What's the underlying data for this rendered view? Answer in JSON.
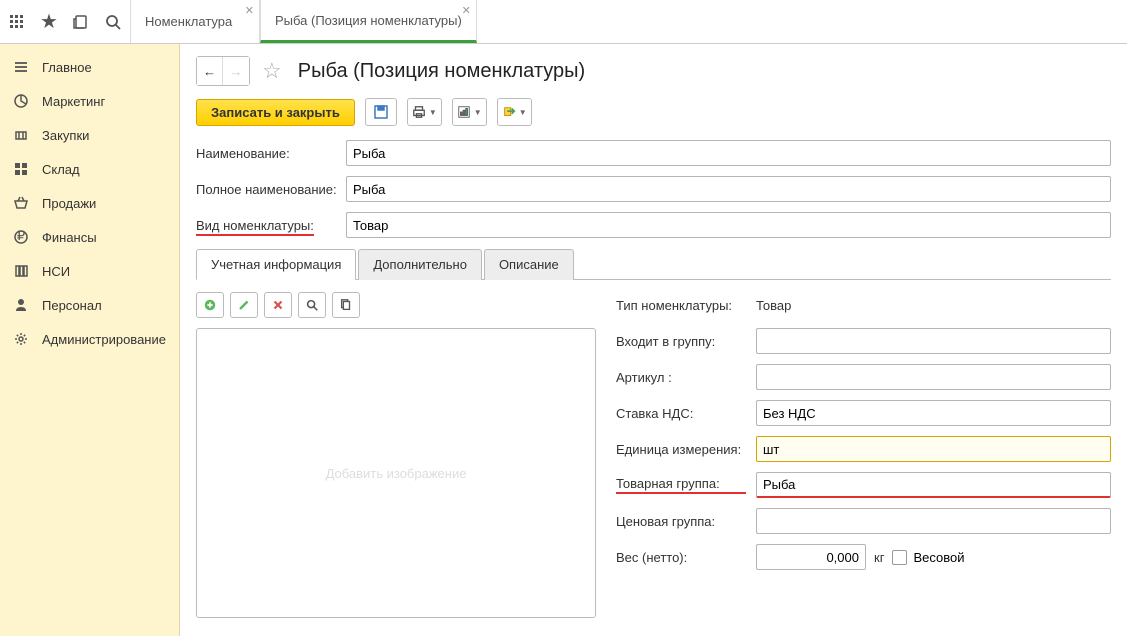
{
  "tabs": {
    "tab1": "Номенклатура",
    "tab2": "Рыба (Позиция номенклатуры)"
  },
  "sidebar": {
    "items": [
      "Главное",
      "Маркетинг",
      "Закупки",
      "Склад",
      "Продажи",
      "Финансы",
      "НСИ",
      "Персонал",
      "Администрирование"
    ]
  },
  "page": {
    "title": "Рыба (Позиция номенклатуры)"
  },
  "toolbar": {
    "save_close": "Записать и закрыть"
  },
  "form": {
    "name_label": "Наименование:",
    "name_value": "Рыба",
    "fullname_label": "Полное наименование:",
    "fullname_value": "Рыба",
    "type_label": "Вид номенклатуры:",
    "type_value": "Товар"
  },
  "subtabs": {
    "tab1": "Учетная информация",
    "tab2": "Дополнительно",
    "tab3": "Описание"
  },
  "image_placeholder": "Добавить изображение",
  "right": {
    "nomen_type_label": "Тип номенклатуры:",
    "nomen_type_value": "Товар",
    "group_label": "Входит в группу:",
    "group_value": "",
    "article_label": "Артикул :",
    "article_value": "",
    "vat_label": "Ставка НДС:",
    "vat_value": "Без НДС",
    "unit_label": "Единица измерения:",
    "unit_value": "шт",
    "prodgroup_label": "Товарная группа:",
    "prodgroup_value": "Рыба",
    "pricegroup_label": "Ценовая группа:",
    "pricegroup_value": "",
    "weight_label": "Вес (нетто):",
    "weight_value": "0,000",
    "weight_unit": "кг",
    "weight_check": "Весовой"
  }
}
